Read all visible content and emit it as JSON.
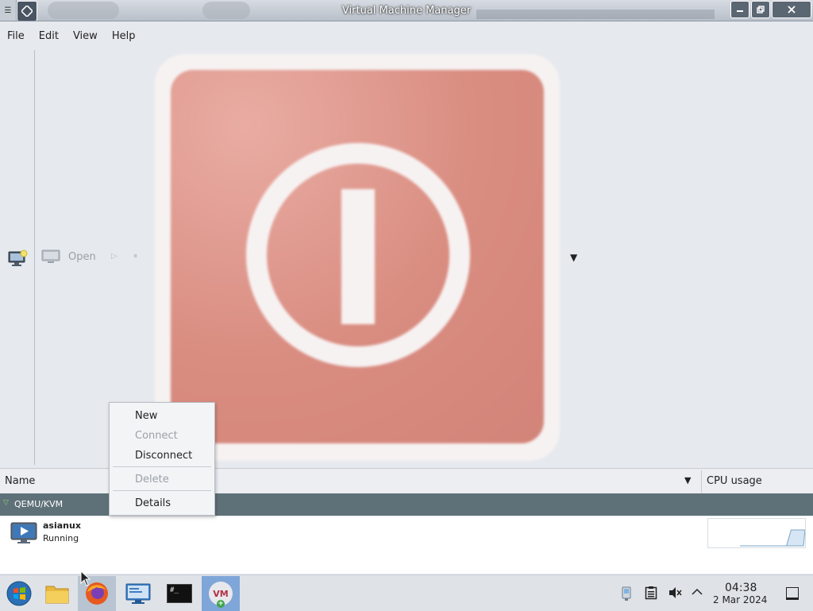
{
  "window": {
    "title": "Virtual Machine Manager",
    "sysmenu_glyph": "☰"
  },
  "menubar": {
    "items": [
      "File",
      "Edit",
      "View",
      "Help"
    ]
  },
  "toolbar": {
    "new_icon": "new-vm-icon",
    "open_label": "Open",
    "play_glyph": "▷",
    "pause_glyph": "⏸",
    "shutdown_icon": "power-icon",
    "dropdown_glyph": "▼"
  },
  "list": {
    "headers": {
      "name": "Name",
      "cpu": "CPU usage",
      "sort_glyph": "▼"
    },
    "group": {
      "label": "QEMU/KVM",
      "expander_glyph": "▽"
    },
    "vm": {
      "name": "asianux",
      "status": "Running",
      "cpu_sparkline": [
        0,
        0,
        0,
        0,
        0,
        0,
        0,
        0,
        0,
        0,
        0,
        1,
        1,
        1,
        1
      ]
    }
  },
  "context_menu": {
    "items": [
      {
        "label": "New",
        "enabled": true
      },
      {
        "label": "Connect",
        "enabled": false
      },
      {
        "label": "Disconnect",
        "enabled": true
      },
      {
        "label": "Delete",
        "enabled": false
      },
      {
        "label": "Details",
        "enabled": true
      }
    ]
  },
  "taskbar": {
    "apps": [
      "start-icon",
      "files-icon",
      "firefox-icon",
      "system-monitor-icon",
      "terminal-icon",
      "virt-manager-icon"
    ],
    "terminal_text": "#_",
    "vmm_text": "VM",
    "clock": {
      "time": "04:38",
      "date": "2 Mar 2024"
    }
  },
  "colors": {
    "accent": "#5f7178",
    "disabled": "#9aa0a8",
    "shutdown": "#d98c80"
  }
}
